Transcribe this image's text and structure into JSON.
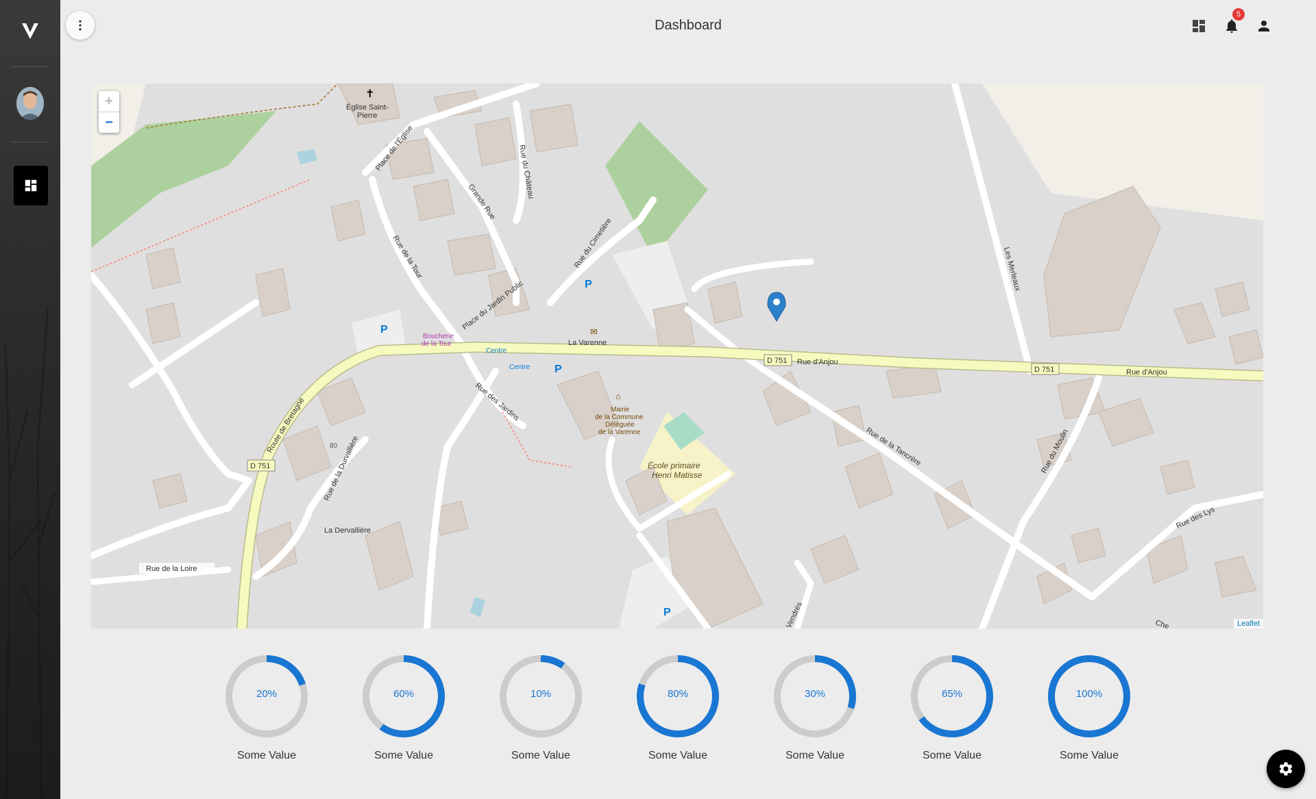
{
  "header": {
    "title": "Dashboard",
    "notification_count": "5",
    "icons": [
      "dashboard-icon",
      "bell-icon",
      "person-icon"
    ]
  },
  "sidebar": {
    "items": [
      {
        "name": "logo",
        "icon": "v-logo-icon"
      },
      {
        "name": "avatar",
        "icon": "user-avatar"
      },
      {
        "name": "dashboard",
        "icon": "dashboard-icon",
        "active": true
      }
    ]
  },
  "map": {
    "zoom_in": "+",
    "zoom_out": "−",
    "attribution": "Leaflet",
    "labels": {
      "eglise": "Église Saint-",
      "eglise2": "Pierre",
      "place_eglise": "Place de l'Église",
      "grande_rue": "Grande Rue",
      "rue_chateau": "Rue du Château",
      "rue_cimetiere": "Rue du Cimetière",
      "rue_tour": "Rue de la Tour",
      "place_jardin": "Place du Jardin Public",
      "boucherie": "Boucherie",
      "boucherie2": "de la Tour",
      "la_varenne": "La Varenne",
      "centre": "Centre",
      "centre2": "Centre",
      "d751_a": "D 751",
      "d751_b": "D 751",
      "d751_c": "D 751",
      "rue_anjou_a": "Rue d'Anjou",
      "rue_anjou_b": "Rue d'Anjou",
      "rue_jardins": "Rue des Jardins",
      "mairie1": "Mairie",
      "mairie2": "de la Commune",
      "mairie3": "Déléguée",
      "mairie4": "de la Varenne",
      "ecole1": "École primaire",
      "ecole2": "Henri Matisse",
      "route_bretagne": "Route de Bretagne",
      "rue_durvalliere": "Rue de la Durvallière",
      "la_dervalliere": "La Dervallière",
      "rue_loire": "Rue de la Loire",
      "rue_tancrere": "Rue de la Tancrère",
      "rue_moulin": "Rue du Moulin",
      "rue_lys": "Rue des Lys",
      "les_merleaux": "Les Merleaux",
      "num80": "80",
      "vendres": "Vendrès",
      "che": "Che"
    }
  },
  "gauges": [
    {
      "value": 20,
      "label": "20%",
      "caption": "Some Value"
    },
    {
      "value": 60,
      "label": "60%",
      "caption": "Some Value"
    },
    {
      "value": 10,
      "label": "10%",
      "caption": "Some Value"
    },
    {
      "value": 80,
      "label": "80%",
      "caption": "Some Value"
    },
    {
      "value": 30,
      "label": "30%",
      "caption": "Some Value"
    },
    {
      "value": 65,
      "label": "65%",
      "caption": "Some Value"
    },
    {
      "value": 100,
      "label": "100%",
      "caption": "Some Value"
    }
  ],
  "colors": {
    "accent": "#1976d2",
    "track": "#cccccc",
    "road_primary": "#f7fabf",
    "building": "#d9d0c9",
    "park": "#add19e"
  },
  "fab": {
    "icon": "gear-icon"
  }
}
